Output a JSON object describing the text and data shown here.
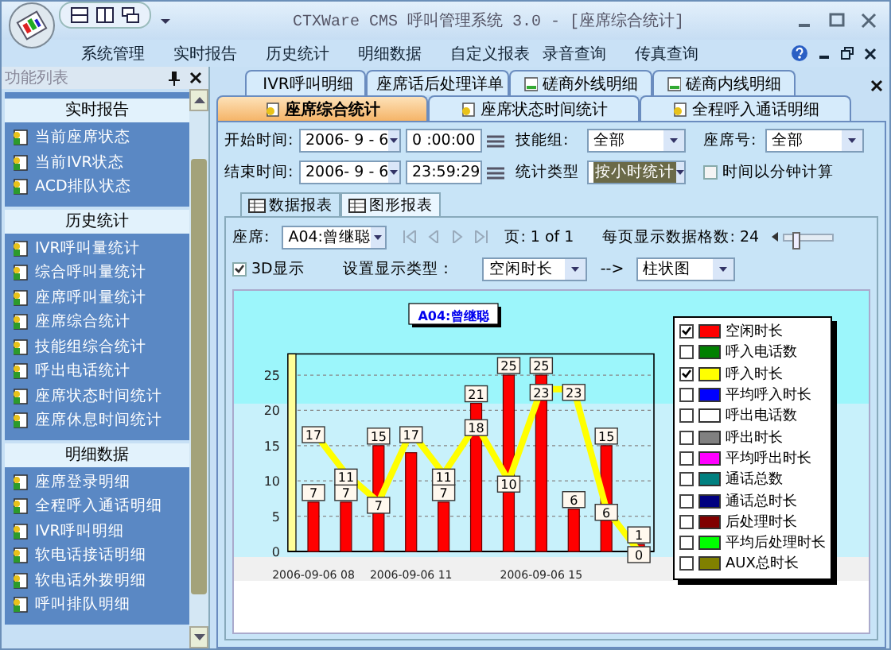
{
  "window": {
    "title": "CTXWare CMS 呼叫管理系统 3.0 - [座席综合统计]"
  },
  "menu": [
    "系统管理",
    "实时报告",
    "历史统计",
    "明细数据",
    "自定义报表",
    "录音查询",
    "传真查询"
  ],
  "sidebar": {
    "title": "功能列表",
    "sections": [
      {
        "label": "实时报告",
        "items": [
          "当前座席状态",
          "当前IVR状态",
          "ACD排队状态"
        ]
      },
      {
        "label": "历史统计",
        "items": [
          "IVR呼叫量统计",
          "综合呼叫量统计",
          "座席呼叫量统计",
          "座席综合统计",
          "技能组综合统计",
          "呼出电话统计",
          "座席状态时间统计",
          "座席休息时间统计"
        ]
      },
      {
        "label": "明细数据",
        "items": [
          "座席登录明细",
          "全程呼入通话明细",
          "IVR呼叫明细",
          "软电话接话明细",
          "软电话外拨明细",
          "呼叫排队明细"
        ]
      }
    ]
  },
  "tabs_back": [
    {
      "label": "IVR呼叫明细",
      "selected": false
    },
    {
      "label": "座席话后处理详单",
      "selected": false
    },
    {
      "label": "磋商外线明细",
      "selected": false
    },
    {
      "label": "磋商内线明细",
      "selected": false
    }
  ],
  "tabs_front": [
    {
      "label": "座席综合统计",
      "selected": true
    },
    {
      "label": "座席状态时间统计",
      "selected": false
    },
    {
      "label": "全程呼入通话明细",
      "selected": false
    }
  ],
  "filters": {
    "start_label": "开始时间:",
    "start_date": "2006- 9 - 6",
    "start_time": "0 :00:00",
    "end_label": "结束时间:",
    "end_date": "2006- 9 - 6",
    "end_time": "23:59:29",
    "skill_label": "技能组:",
    "skill_value": "全部",
    "type_label": "统计类型",
    "type_value": "按小时统计",
    "seat_label": "座席号:",
    "seat_value": "全部",
    "minutes": {
      "label": "时间以分钟计算",
      "checked": false
    }
  },
  "report_tabs": [
    {
      "label": "数据报表",
      "selected": false
    },
    {
      "label": "图形报表",
      "selected": true
    }
  ],
  "toolbar": {
    "seat_label": "座席:",
    "seat_value": "A04:曾继聪",
    "page": "页: 1 of 1",
    "per_page": "每页显示数据格数: 24",
    "level": 0.2
  },
  "display": {
    "three_d": {
      "label": "3D显示",
      "checked": true
    },
    "type_label": "设置显示类型：",
    "type_value": "空闲时长",
    "arrow": "-->",
    "style_value": "柱状图"
  },
  "chart": {
    "title": "A04:曾继聪",
    "chart_data": {
      "type": "bar",
      "categories": [
        "2006-09-06 08",
        null,
        null,
        "2006-09-06 11",
        null,
        null,
        null,
        "2006-09-06 15",
        null,
        null,
        null
      ],
      "yticks": [
        0,
        5,
        10,
        15,
        20,
        25
      ],
      "ylim": [
        0,
        28
      ],
      "grid": true,
      "series": [
        {
          "type": "bar",
          "color": "#ff0000",
          "values": [
            7,
            7,
            15,
            14,
            7,
            21,
            25,
            25,
            6,
            15,
            1
          ],
          "value_labels": [
            "7",
            "7",
            "15",
            null,
            "7",
            "21",
            "25",
            "25",
            "6",
            "15",
            "1"
          ]
        },
        {
          "type": "line",
          "color": "#ffff00",
          "marker": "none",
          "values": [
            17,
            11,
            7,
            17,
            11,
            18,
            10,
            23,
            23,
            6,
            0
          ],
          "value_labels": [
            "17",
            "11",
            "7",
            "17",
            "11",
            "18",
            "10",
            "23",
            "23",
            "6",
            "0"
          ]
        }
      ]
    },
    "legend": [
      {
        "label": "空闲时长",
        "color": "#ff0000",
        "checked": true
      },
      {
        "label": "呼入电话数",
        "color": "#008000",
        "checked": false
      },
      {
        "label": "呼入时长",
        "color": "#ffff00",
        "checked": true
      },
      {
        "label": "平均呼入时长",
        "color": "#0000ff",
        "checked": false
      },
      {
        "label": "呼出电话数",
        "color": "#ffffff",
        "checked": false
      },
      {
        "label": "呼出时长",
        "color": "#808080",
        "checked": false
      },
      {
        "label": "平均呼出时长",
        "color": "#ff00ff",
        "checked": false
      },
      {
        "label": "通话总数",
        "color": "#008080",
        "checked": false
      },
      {
        "label": "通话总时长",
        "color": "#000080",
        "checked": false
      },
      {
        "label": "后处理时长",
        "color": "#800000",
        "checked": false
      },
      {
        "label": "平均后处理时长",
        "color": "#00ff00",
        "checked": false
      },
      {
        "label": "AUX总时长",
        "color": "#808000",
        "checked": false
      }
    ]
  }
}
